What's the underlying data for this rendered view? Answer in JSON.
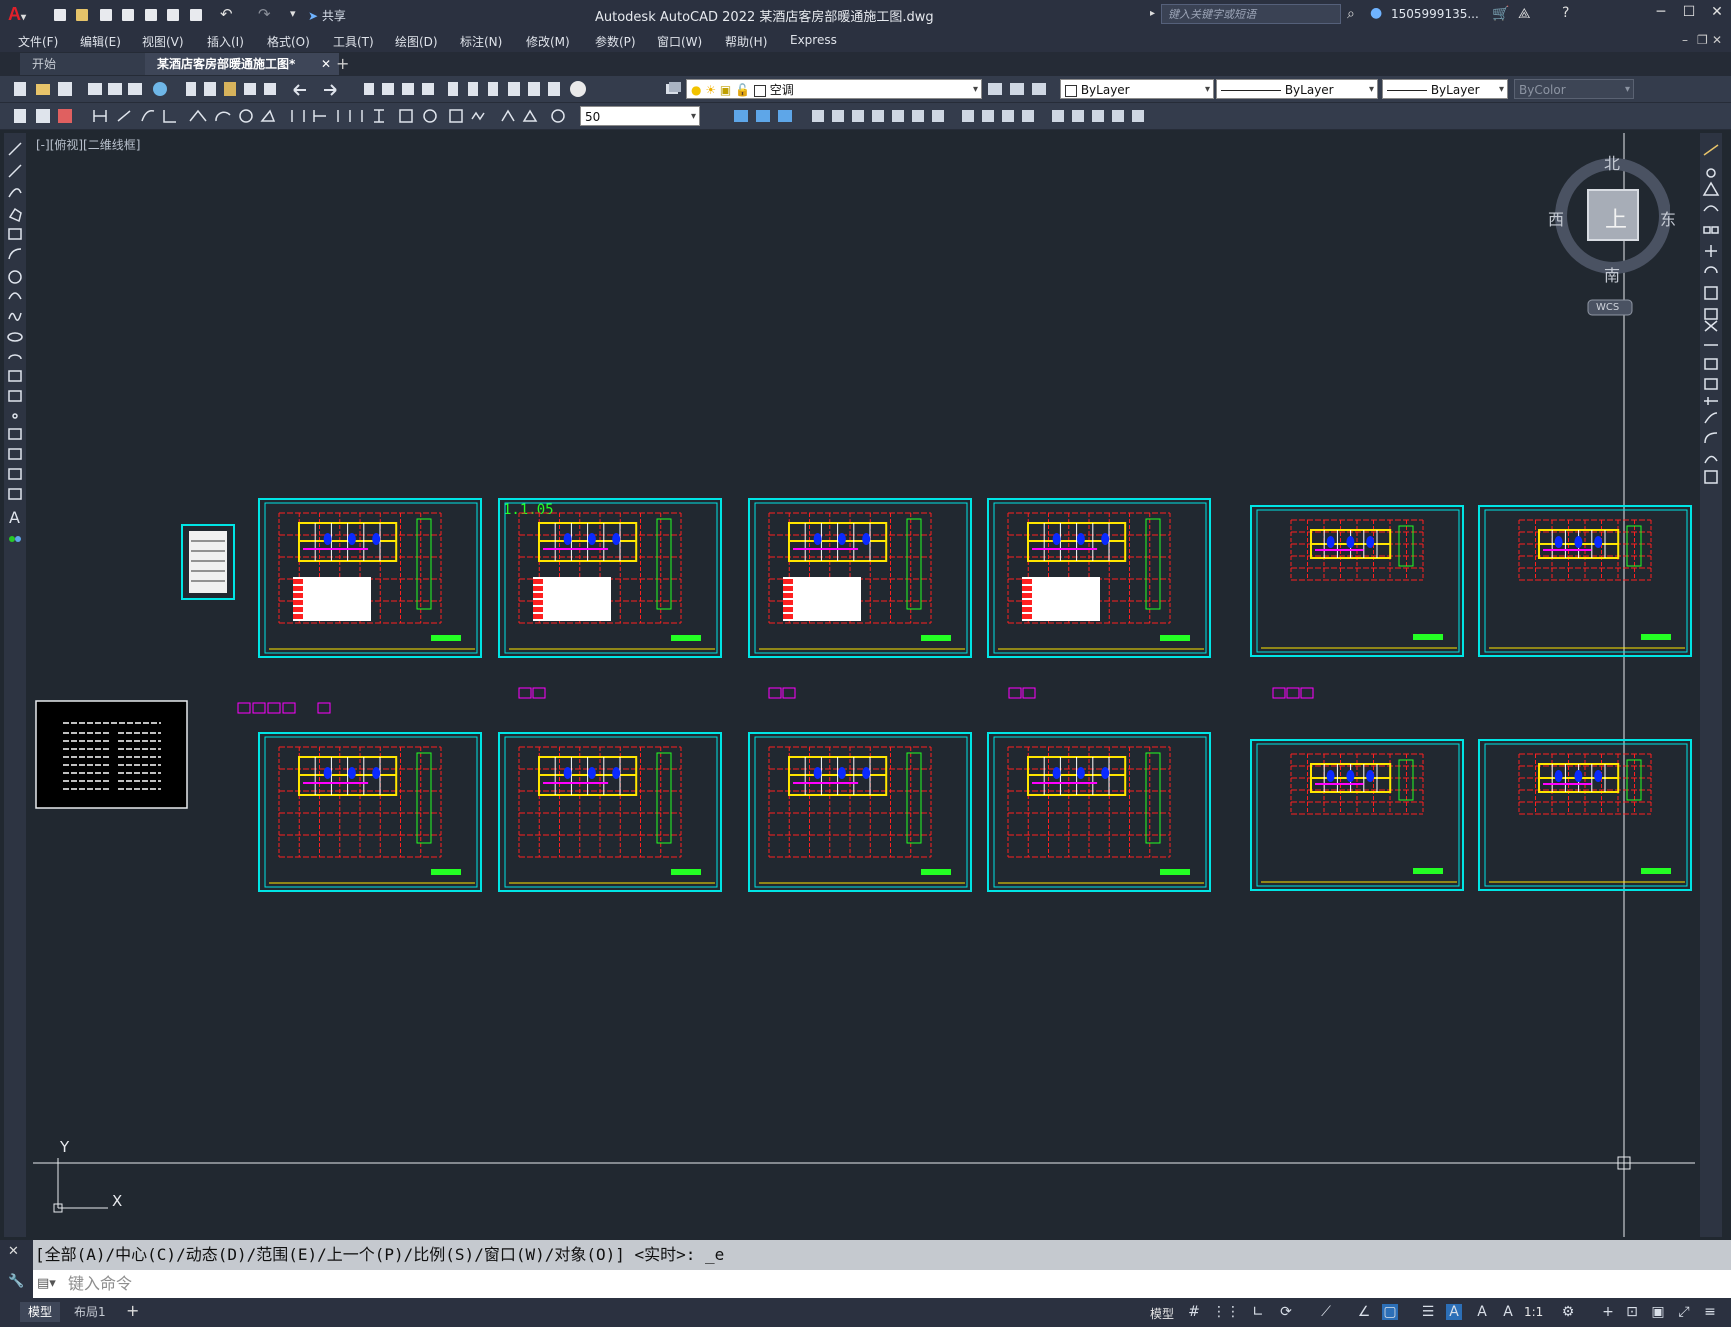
{
  "window": {
    "title": "Autodesk AutoCAD 2022    某酒店客房部暖通施工图.dwg",
    "share_label": "共享",
    "search_placeholder": "键入关键字或短语",
    "user": "1505999135...",
    "controls": [
      "─",
      "☐",
      "✕"
    ]
  },
  "menu": [
    "文件(F)",
    "编辑(E)",
    "视图(V)",
    "插入(I)",
    "格式(O)",
    "工具(T)",
    "绘图(D)",
    "标注(N)",
    "修改(M)",
    "参数(P)",
    "窗口(W)",
    "帮助(H)",
    "Express"
  ],
  "tabs": [
    {
      "label": "开始",
      "active": false
    },
    {
      "label": "某酒店客房部暖通施工图*",
      "active": true
    }
  ],
  "toolbar": {
    "layer_name": "空调",
    "color": "ByLayer",
    "linetype": "ByLayer",
    "lineweight": "ByLayer",
    "plotstyle": "ByColor",
    "dim_value": "50"
  },
  "viewport": {
    "label": "[-][俯视][二维线框]"
  },
  "viewcube": {
    "north": "北",
    "south": "南",
    "east": "东",
    "west": "西",
    "top": "上",
    "wcs": "WCS"
  },
  "drawing": {
    "sheet_label": "1.1.05"
  },
  "ucs": {
    "x_label": "X",
    "y_label": "Y"
  },
  "command": {
    "history": "[全部(A)/中心(C)/动态(D)/范围(E)/上一个(P)/比例(S)/窗口(W)/对象(O)] <实时>: _e",
    "placeholder": "键入命令"
  },
  "status": {
    "tabs": [
      {
        "label": "模型",
        "active": true
      },
      {
        "label": "布局1",
        "active": false
      }
    ],
    "model_label": "模型",
    "scale": "1:1"
  },
  "colors": {
    "background": "#212830",
    "accent_cyan": "#00e5e5",
    "red": "#ff2020",
    "yellow": "#ffe600",
    "blue": "#0a2aff",
    "magenta": "#ff00ff",
    "green": "#24ff24"
  }
}
